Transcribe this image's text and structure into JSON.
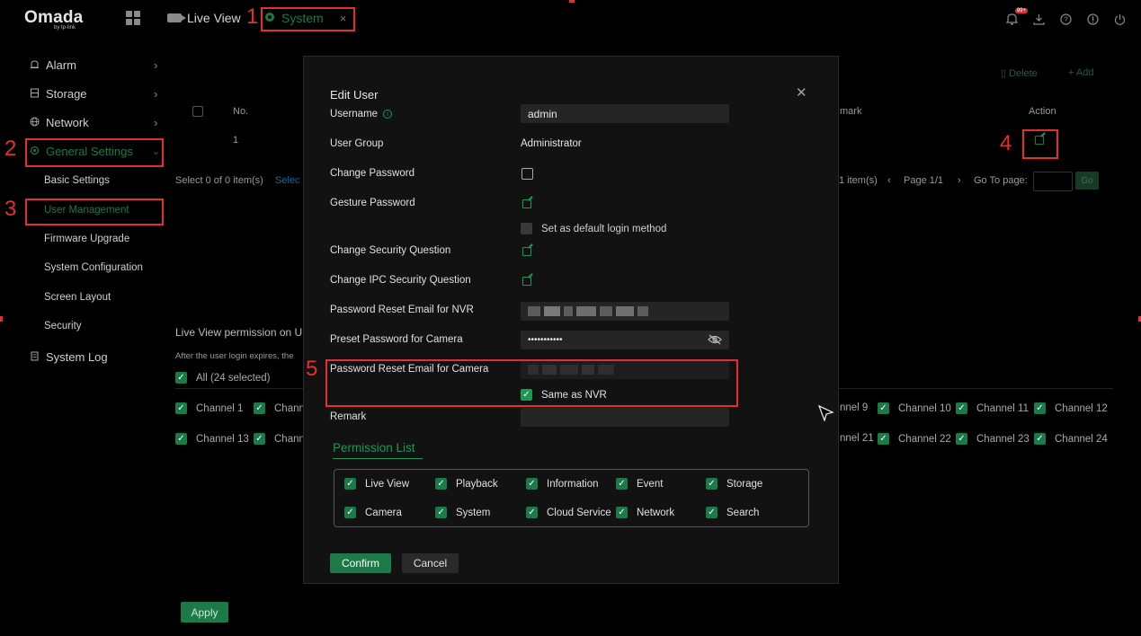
{
  "app": {
    "logo": "Omada",
    "logo_sub": "by tp-link",
    "notification_badge": "99+"
  },
  "tabs": {
    "live_view": "Live View",
    "system": "System",
    "close": "×"
  },
  "sidebar": {
    "items": [
      {
        "label": "Alarm",
        "icon": "alarm-icon"
      },
      {
        "label": "Storage",
        "icon": "storage-icon"
      },
      {
        "label": "Network",
        "icon": "network-icon"
      },
      {
        "label": "General Settings",
        "icon": "settings-icon"
      },
      {
        "label": "System Log",
        "icon": "log-icon"
      }
    ],
    "sub_items": [
      "Basic Settings",
      "User Management",
      "Firmware Upgrade",
      "System Configuration",
      "Screen Layout",
      "Security"
    ]
  },
  "background": {
    "delete": "Delete",
    "add": "Add",
    "col_no": "No.",
    "col_remark": "mark",
    "col_action": "Action",
    "row_no": "1",
    "select_text": "Select 0 of 0 item(s)",
    "select_link": "Selec",
    "pager": "1 item(s)",
    "page": "Page 1/1",
    "goto": "Go To page:",
    "go": "Go",
    "perm_title": "Live View permission on U",
    "perm_note": "After the user login expires, the",
    "all": "All  (24 selected)",
    "ch_left_row1": [
      "Channel 1",
      "Chann"
    ],
    "ch_left_row2": [
      "Channel 13",
      "Chann"
    ],
    "ch_right_row1": [
      "nnel 9",
      "Channel 10",
      "Channel 11",
      "Channel 12"
    ],
    "ch_right_row2": [
      "nnel 21",
      "Channel 22",
      "Channel 23",
      "Channel 24"
    ],
    "apply": "Apply"
  },
  "annotations": [
    "1",
    "2",
    "3",
    "4",
    "5"
  ],
  "modal": {
    "title": "Edit User",
    "username_label": "Username",
    "username_value": "admin",
    "user_group_label": "User Group",
    "user_group_value": "Administrator",
    "change_password_label": "Change Password",
    "gesture_label": "Gesture Password",
    "default_login": "Set as default login method",
    "security_q_label": "Change Security Question",
    "ipc_security_q_label": "Change IPC Security Question",
    "reset_email_nvr_label": "Password Reset Email for NVR",
    "preset_pwd_label": "Preset Password for Camera",
    "preset_pwd_value": "•••••••••••",
    "reset_email_cam_label": "Password Reset Email for Camera",
    "same_as_nvr": "Same as NVR",
    "remark_label": "Remark",
    "permission_tab": "Permission List",
    "permissions_row1": [
      "Live View",
      "Playback",
      "Information",
      "Event",
      "Storage"
    ],
    "permissions_row2": [
      "Camera",
      "System",
      "Cloud Service",
      "Network",
      "Search"
    ],
    "confirm": "Confirm",
    "cancel": "Cancel"
  },
  "colors": {
    "accent": "#1b7a47",
    "annotation": "#e23030",
    "background": "#000000"
  }
}
